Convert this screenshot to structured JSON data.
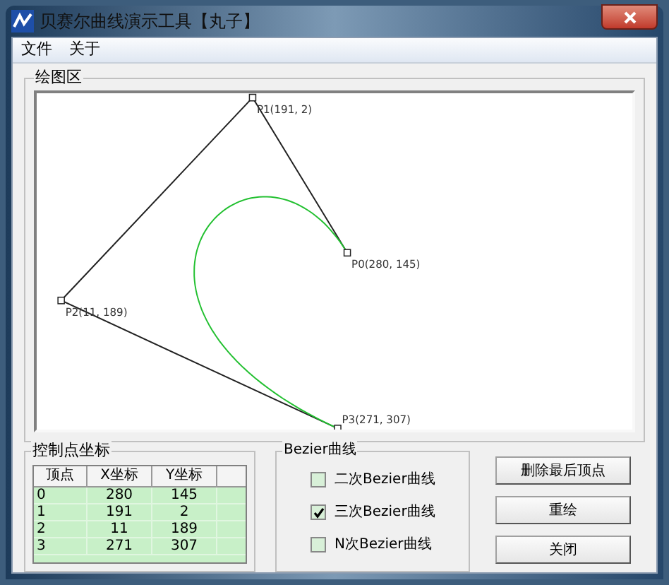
{
  "window": {
    "title": "贝赛尔曲线演示工具【丸子】"
  },
  "menu": [
    "文件",
    "关于"
  ],
  "canvas": {
    "title": "绘图区",
    "point_labels": [
      "P0(280, 145)",
      "P1(191, 2)",
      "P2(11, 189)",
      "P3(271, 307)"
    ]
  },
  "points_table": {
    "title": "控制点坐标",
    "columns": [
      "顶点",
      "X坐标",
      "Y坐标"
    ],
    "rows": [
      [
        "0",
        "280",
        "145"
      ],
      [
        "1",
        "191",
        "2"
      ],
      [
        "2",
        "11",
        "189"
      ],
      [
        "3",
        "271",
        "307"
      ]
    ]
  },
  "curve_options": {
    "title": "Bezier曲线",
    "items": [
      {
        "label": "二次Bezier曲线",
        "checked": false
      },
      {
        "label": "三次Bezier曲线",
        "checked": true
      },
      {
        "label": "N次Bezier曲线",
        "checked": false
      }
    ]
  },
  "buttons": [
    "删除最后顶点",
    "重绘",
    "关闭"
  ]
}
